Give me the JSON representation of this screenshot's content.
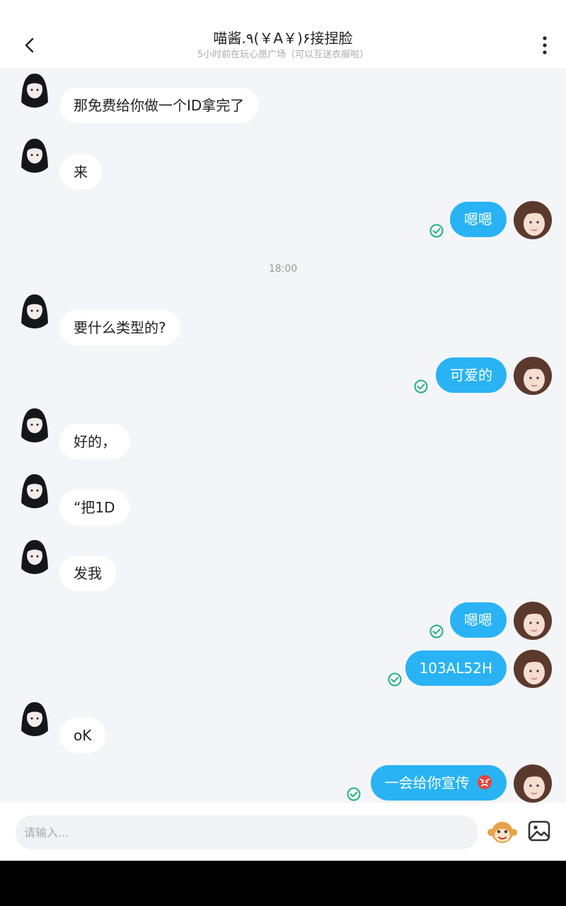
{
  "header": {
    "title": "喵酱.٩(￥A￥)۶接捏脸",
    "subtitle": "5小时前在玩心愿广场（可以互送衣服啦）"
  },
  "messages": [
    {
      "side": "in",
      "text": "那免费给你做一个ID拿完了"
    },
    {
      "side": "in",
      "text": "来"
    },
    {
      "side": "out",
      "text": "嗯嗯"
    },
    {
      "side": "in",
      "text": "要什么类型的?"
    },
    {
      "side": "out",
      "text": "可爱的"
    },
    {
      "side": "in",
      "text": "好的，"
    },
    {
      "side": "in",
      "text": "“把1D"
    },
    {
      "side": "in",
      "text": "发我"
    },
    {
      "side": "out",
      "text": "嗯嗯"
    },
    {
      "side": "out",
      "text": "103AL52H"
    },
    {
      "side": "in",
      "text": "oK"
    },
    {
      "side": "out",
      "text": "一会给你宣传",
      "emoji": "angry-face"
    }
  ],
  "time_separator": "18:00",
  "input": {
    "placeholder": "请输入..."
  },
  "icons": {
    "back": "back-arrow-icon",
    "more": "more-vertical-icon",
    "read": "read-check-icon",
    "emoji": "monkey-emoji-icon",
    "image": "image-picker-icon"
  },
  "colors": {
    "accent": "#29b3f4",
    "read_tick": "#20b37b",
    "background": "#f4f5f9"
  }
}
